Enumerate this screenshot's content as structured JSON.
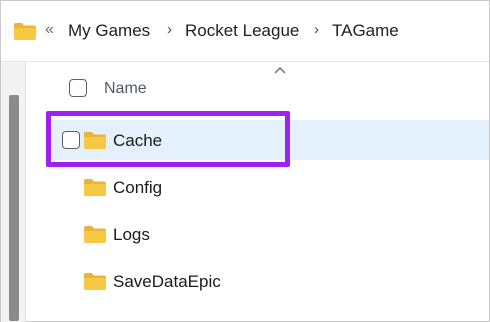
{
  "breadcrumb": {
    "folder_icon": "folder-icon",
    "overflow": "«",
    "items": [
      "My Games",
      "Rocket League",
      "TAGame"
    ],
    "separator": "›"
  },
  "file_list": {
    "column_header": "Name",
    "sort_indicator": "chevron-up-icon",
    "rows": [
      {
        "name": "Cache",
        "icon": "folder-icon",
        "selected": true,
        "highlighted": true
      },
      {
        "name": "Config",
        "icon": "folder-icon",
        "selected": false
      },
      {
        "name": "Logs",
        "icon": "folder-icon",
        "selected": false
      },
      {
        "name": "SaveDataEpic",
        "icon": "folder-icon",
        "selected": false
      }
    ]
  },
  "colors": {
    "highlight": "#a020f0",
    "selected_row": "#e4f0fb",
    "folder": "#f6c945"
  }
}
